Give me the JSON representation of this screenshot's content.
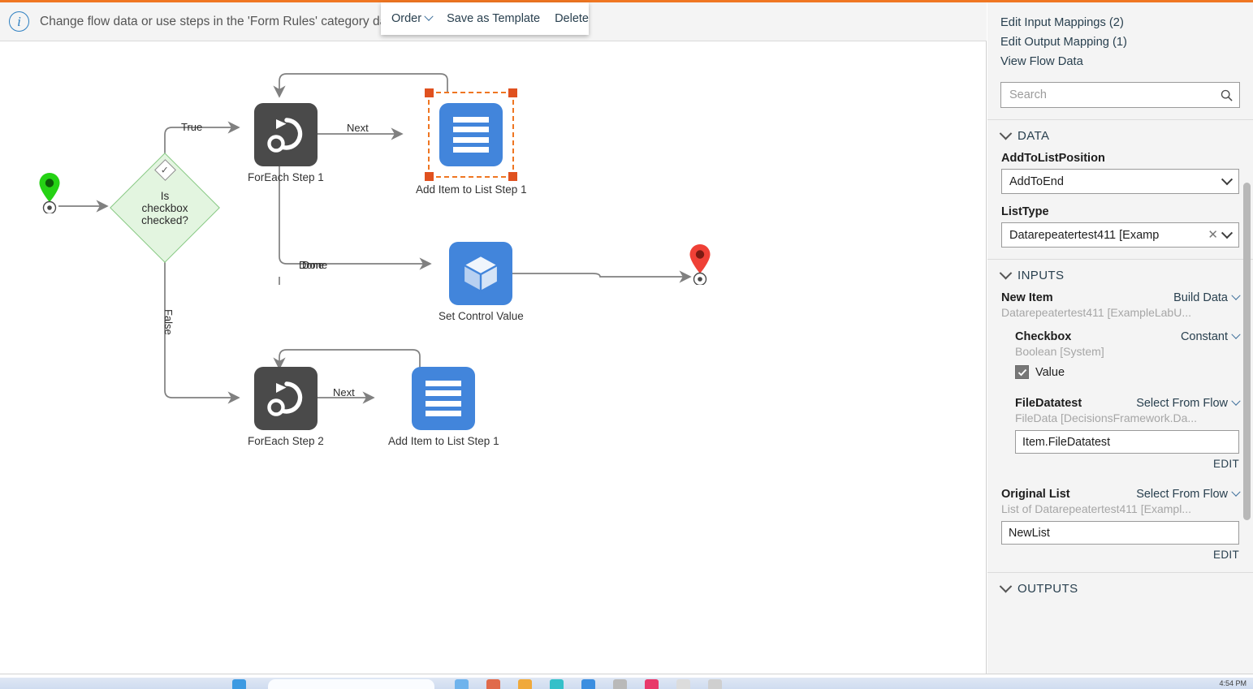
{
  "banner": {
    "icon": "info-icon",
    "text": "Change flow data or use steps in the 'Form Rules' category                                  dation"
  },
  "context_menu": {
    "items": [
      {
        "label": "Order",
        "has_caret": true
      },
      {
        "label": "Save as Template",
        "has_caret": false
      },
      {
        "label": "Delete",
        "has_caret": false
      }
    ]
  },
  "canvas": {
    "nodes": [
      {
        "id": "start",
        "type": "start-pin",
        "label": ""
      },
      {
        "id": "decision",
        "type": "decision",
        "label": "Is\ncheckbox\nchecked?",
        "line1": "Is",
        "line2": "checkbox",
        "line3": "checked?"
      },
      {
        "id": "foreach1",
        "type": "foreach",
        "label": "ForEach Step 1"
      },
      {
        "id": "additem1",
        "type": "add-item-to-list",
        "label": "Add Item to List Step 1",
        "selected": true
      },
      {
        "id": "setcontrol",
        "type": "set-control-value",
        "label": "Set Control Value"
      },
      {
        "id": "foreach2",
        "type": "foreach",
        "label": "ForEach Step 2"
      },
      {
        "id": "additem2",
        "type": "add-item-to-list",
        "label": "Add Item to List Step 1",
        "selected": false
      },
      {
        "id": "end",
        "type": "end-pin",
        "label": ""
      }
    ],
    "edge_labels": {
      "true": "True",
      "false": "False",
      "next1": "Next",
      "next2": "Next",
      "done": "Done",
      "done_overlap": "Done"
    },
    "colors": {
      "dark_node": "#4a4a4a",
      "blue_node": "#4285db",
      "decision_fill": "#e3f5e0",
      "decision_stroke": "#86c882",
      "start_pin": "#25d214",
      "end_pin": "#ef4036",
      "selection": "#ef7622",
      "edge": "#808080"
    }
  },
  "right_panel": {
    "links": [
      "Edit Input Mappings (2)",
      "Edit Output Mapping (1)",
      "View Flow Data"
    ],
    "search": {
      "placeholder": "Search",
      "value": "",
      "icon": "search-icon"
    },
    "sections": {
      "data": {
        "title": "DATA",
        "fields": [
          {
            "label": "AddToListPosition",
            "value": "AddToEnd",
            "control": "dropdown",
            "clearable": false
          },
          {
            "label": "ListType",
            "value": "Datarepeatertest411  [Examp",
            "control": "dropdown",
            "clearable": true
          }
        ]
      },
      "inputs": {
        "title": "INPUTS",
        "items": [
          {
            "name": "New Item",
            "mode": "Build Data",
            "type": "Datarepeatertest411 [ExampleLabU...",
            "indent": 0
          },
          {
            "name": "Checkbox",
            "mode": "Constant",
            "type": "Boolean [System]",
            "indent": 1,
            "checkbox": {
              "label": "Value",
              "checked": true
            }
          },
          {
            "name": "FileDatatest",
            "mode": "Select From Flow",
            "type": "FileData [DecisionsFramework.Da...",
            "indent": 1,
            "input_value": "Item.FileDatatest",
            "edit_label": "EDIT"
          },
          {
            "name": "Original List",
            "mode": "Select From Flow",
            "type": "List of Datarepeatertest411 [Exampl...",
            "indent": 0,
            "input_value": "NewList",
            "edit_label": "EDIT"
          }
        ]
      },
      "outputs": {
        "title": "OUTPUTS"
      }
    }
  },
  "taskbar": {
    "clock": "4:54 PM"
  },
  "theme": {
    "accent": "#ef7622",
    "link": "#29404f",
    "panel_bg": "#f4f4f4",
    "banner_bg": "#f4f4f4"
  }
}
